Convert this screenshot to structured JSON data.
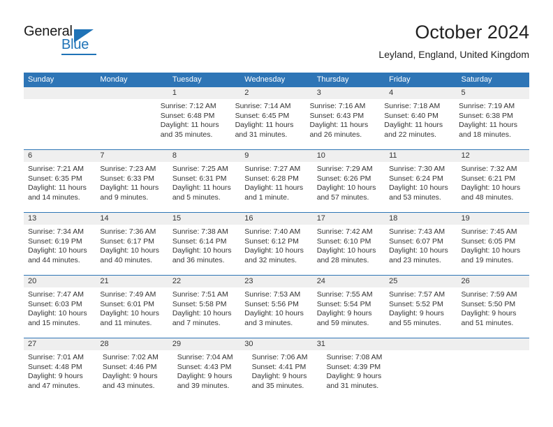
{
  "brand": {
    "name_part1": "General",
    "name_part2": "Blue",
    "accent_color": "#1f73b7"
  },
  "header": {
    "title": "October 2024",
    "subtitle": "Leyland, England, United Kingdom"
  },
  "theme": {
    "header_row_color": "#2e75b6",
    "date_band_color": "#efefef",
    "text_color": "#333333"
  },
  "weekdays": [
    "Sunday",
    "Monday",
    "Tuesday",
    "Wednesday",
    "Thursday",
    "Friday",
    "Saturday"
  ],
  "weeks": [
    {
      "dates": [
        "",
        "",
        "1",
        "2",
        "3",
        "4",
        "5"
      ],
      "cells": [
        {
          "empty": true
        },
        {
          "empty": true
        },
        {
          "sunrise": "Sunrise: 7:12 AM",
          "sunset": "Sunset: 6:48 PM",
          "daylight_line1": "Daylight: 11 hours",
          "daylight_line2": "and 35 minutes."
        },
        {
          "sunrise": "Sunrise: 7:14 AM",
          "sunset": "Sunset: 6:45 PM",
          "daylight_line1": "Daylight: 11 hours",
          "daylight_line2": "and 31 minutes."
        },
        {
          "sunrise": "Sunrise: 7:16 AM",
          "sunset": "Sunset: 6:43 PM",
          "daylight_line1": "Daylight: 11 hours",
          "daylight_line2": "and 26 minutes."
        },
        {
          "sunrise": "Sunrise: 7:18 AM",
          "sunset": "Sunset: 6:40 PM",
          "daylight_line1": "Daylight: 11 hours",
          "daylight_line2": "and 22 minutes."
        },
        {
          "sunrise": "Sunrise: 7:19 AM",
          "sunset": "Sunset: 6:38 PM",
          "daylight_line1": "Daylight: 11 hours",
          "daylight_line2": "and 18 minutes."
        }
      ]
    },
    {
      "dates": [
        "6",
        "7",
        "8",
        "9",
        "10",
        "11",
        "12"
      ],
      "cells": [
        {
          "sunrise": "Sunrise: 7:21 AM",
          "sunset": "Sunset: 6:35 PM",
          "daylight_line1": "Daylight: 11 hours",
          "daylight_line2": "and 14 minutes."
        },
        {
          "sunrise": "Sunrise: 7:23 AM",
          "sunset": "Sunset: 6:33 PM",
          "daylight_line1": "Daylight: 11 hours",
          "daylight_line2": "and 9 minutes."
        },
        {
          "sunrise": "Sunrise: 7:25 AM",
          "sunset": "Sunset: 6:31 PM",
          "daylight_line1": "Daylight: 11 hours",
          "daylight_line2": "and 5 minutes."
        },
        {
          "sunrise": "Sunrise: 7:27 AM",
          "sunset": "Sunset: 6:28 PM",
          "daylight_line1": "Daylight: 11 hours",
          "daylight_line2": "and 1 minute."
        },
        {
          "sunrise": "Sunrise: 7:29 AM",
          "sunset": "Sunset: 6:26 PM",
          "daylight_line1": "Daylight: 10 hours",
          "daylight_line2": "and 57 minutes."
        },
        {
          "sunrise": "Sunrise: 7:30 AM",
          "sunset": "Sunset: 6:24 PM",
          "daylight_line1": "Daylight: 10 hours",
          "daylight_line2": "and 53 minutes."
        },
        {
          "sunrise": "Sunrise: 7:32 AM",
          "sunset": "Sunset: 6:21 PM",
          "daylight_line1": "Daylight: 10 hours",
          "daylight_line2": "and 48 minutes."
        }
      ]
    },
    {
      "dates": [
        "13",
        "14",
        "15",
        "16",
        "17",
        "18",
        "19"
      ],
      "cells": [
        {
          "sunrise": "Sunrise: 7:34 AM",
          "sunset": "Sunset: 6:19 PM",
          "daylight_line1": "Daylight: 10 hours",
          "daylight_line2": "and 44 minutes."
        },
        {
          "sunrise": "Sunrise: 7:36 AM",
          "sunset": "Sunset: 6:17 PM",
          "daylight_line1": "Daylight: 10 hours",
          "daylight_line2": "and 40 minutes."
        },
        {
          "sunrise": "Sunrise: 7:38 AM",
          "sunset": "Sunset: 6:14 PM",
          "daylight_line1": "Daylight: 10 hours",
          "daylight_line2": "and 36 minutes."
        },
        {
          "sunrise": "Sunrise: 7:40 AM",
          "sunset": "Sunset: 6:12 PM",
          "daylight_line1": "Daylight: 10 hours",
          "daylight_line2": "and 32 minutes."
        },
        {
          "sunrise": "Sunrise: 7:42 AM",
          "sunset": "Sunset: 6:10 PM",
          "daylight_line1": "Daylight: 10 hours",
          "daylight_line2": "and 28 minutes."
        },
        {
          "sunrise": "Sunrise: 7:43 AM",
          "sunset": "Sunset: 6:07 PM",
          "daylight_line1": "Daylight: 10 hours",
          "daylight_line2": "and 23 minutes."
        },
        {
          "sunrise": "Sunrise: 7:45 AM",
          "sunset": "Sunset: 6:05 PM",
          "daylight_line1": "Daylight: 10 hours",
          "daylight_line2": "and 19 minutes."
        }
      ]
    },
    {
      "dates": [
        "20",
        "21",
        "22",
        "23",
        "24",
        "25",
        "26"
      ],
      "cells": [
        {
          "sunrise": "Sunrise: 7:47 AM",
          "sunset": "Sunset: 6:03 PM",
          "daylight_line1": "Daylight: 10 hours",
          "daylight_line2": "and 15 minutes."
        },
        {
          "sunrise": "Sunrise: 7:49 AM",
          "sunset": "Sunset: 6:01 PM",
          "daylight_line1": "Daylight: 10 hours",
          "daylight_line2": "and 11 minutes."
        },
        {
          "sunrise": "Sunrise: 7:51 AM",
          "sunset": "Sunset: 5:58 PM",
          "daylight_line1": "Daylight: 10 hours",
          "daylight_line2": "and 7 minutes."
        },
        {
          "sunrise": "Sunrise: 7:53 AM",
          "sunset": "Sunset: 5:56 PM",
          "daylight_line1": "Daylight: 10 hours",
          "daylight_line2": "and 3 minutes."
        },
        {
          "sunrise": "Sunrise: 7:55 AM",
          "sunset": "Sunset: 5:54 PM",
          "daylight_line1": "Daylight: 9 hours",
          "daylight_line2": "and 59 minutes."
        },
        {
          "sunrise": "Sunrise: 7:57 AM",
          "sunset": "Sunset: 5:52 PM",
          "daylight_line1": "Daylight: 9 hours",
          "daylight_line2": "and 55 minutes."
        },
        {
          "sunrise": "Sunrise: 7:59 AM",
          "sunset": "Sunset: 5:50 PM",
          "daylight_line1": "Daylight: 9 hours",
          "daylight_line2": "and 51 minutes."
        }
      ]
    },
    {
      "dates": [
        "27",
        "28",
        "29",
        "30",
        "31",
        "",
        ""
      ],
      "cells": [
        {
          "sunrise": "Sunrise: 7:01 AM",
          "sunset": "Sunset: 4:48 PM",
          "daylight_line1": "Daylight: 9 hours",
          "daylight_line2": "and 47 minutes."
        },
        {
          "sunrise": "Sunrise: 7:02 AM",
          "sunset": "Sunset: 4:46 PM",
          "daylight_line1": "Daylight: 9 hours",
          "daylight_line2": "and 43 minutes."
        },
        {
          "sunrise": "Sunrise: 7:04 AM",
          "sunset": "Sunset: 4:43 PM",
          "daylight_line1": "Daylight: 9 hours",
          "daylight_line2": "and 39 minutes."
        },
        {
          "sunrise": "Sunrise: 7:06 AM",
          "sunset": "Sunset: 4:41 PM",
          "daylight_line1": "Daylight: 9 hours",
          "daylight_line2": "and 35 minutes."
        },
        {
          "sunrise": "Sunrise: 7:08 AM",
          "sunset": "Sunset: 4:39 PM",
          "daylight_line1": "Daylight: 9 hours",
          "daylight_line2": "and 31 minutes."
        },
        {
          "empty": true
        },
        {
          "empty": true
        }
      ]
    }
  ]
}
